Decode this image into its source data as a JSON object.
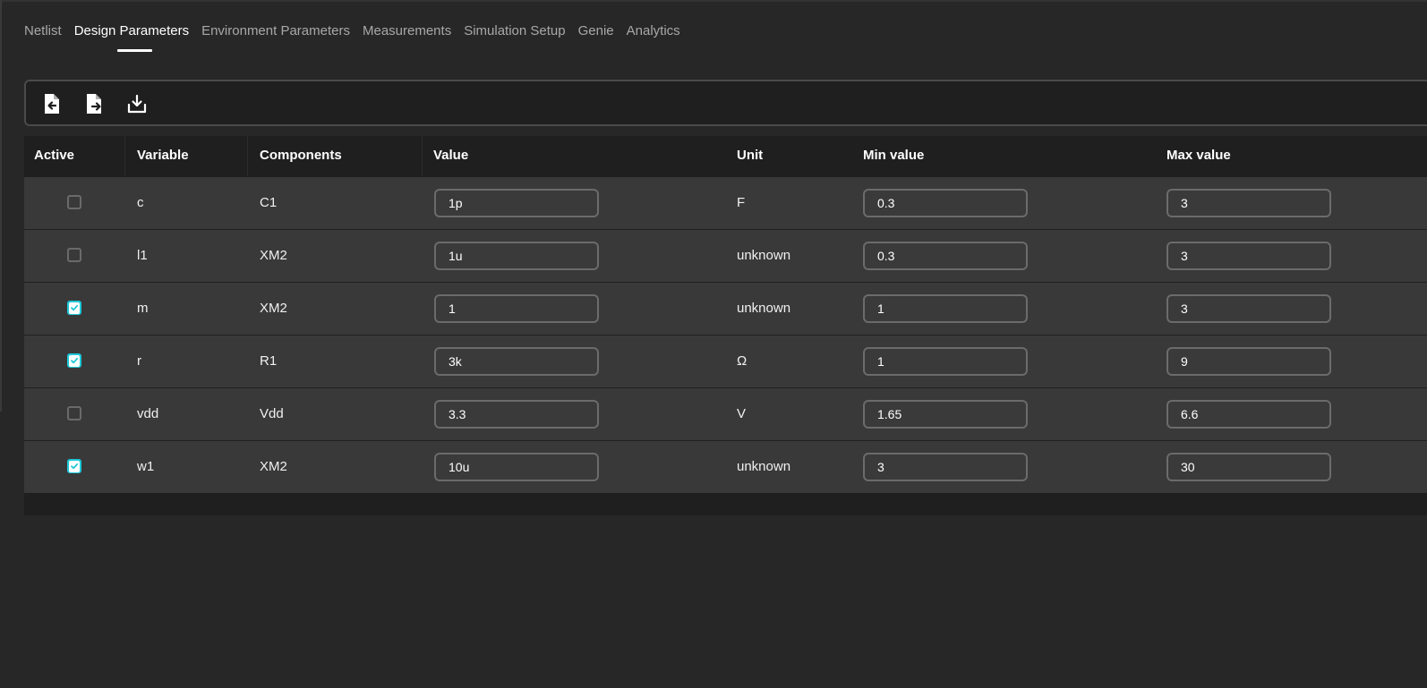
{
  "tabs": [
    {
      "label": "Netlist"
    },
    {
      "label": "Design Parameters"
    },
    {
      "label": "Environment Parameters"
    },
    {
      "label": "Measurements"
    },
    {
      "label": "Simulation Setup"
    },
    {
      "label": "Genie"
    },
    {
      "label": "Analytics"
    }
  ],
  "active_tab": "Design Parameters",
  "toolbar": {
    "buttons": [
      "file-import-icon",
      "file-export-icon",
      "download-icon"
    ]
  },
  "columns": {
    "active": "Active",
    "variable": "Variable",
    "components": "Components",
    "value": "Value",
    "unit": "Unit",
    "min": "Min value",
    "max": "Max value"
  },
  "rows": [
    {
      "active": false,
      "variable": "c",
      "components": "C1",
      "value": "1p",
      "unit": "F",
      "min": "0.3",
      "max": "3"
    },
    {
      "active": false,
      "variable": "l1",
      "components": "XM2",
      "value": "1u",
      "unit": "unknown",
      "min": "0.3",
      "max": "3"
    },
    {
      "active": true,
      "variable": "m",
      "components": "XM2",
      "value": "1",
      "unit": "unknown",
      "min": "1",
      "max": "3"
    },
    {
      "active": true,
      "variable": "r",
      "components": "R1",
      "value": "3k",
      "unit": "Ω",
      "min": "1",
      "max": "9"
    },
    {
      "active": false,
      "variable": "vdd",
      "components": "Vdd",
      "value": "3.3",
      "unit": "V",
      "min": "1.65",
      "max": "6.6"
    },
    {
      "active": true,
      "variable": "w1",
      "components": "XM2",
      "value": "10u",
      "unit": "unknown",
      "min": "3",
      "max": "30"
    }
  ],
  "colors": {
    "accent": "#1ec8d8",
    "background": "#272727",
    "row": "#393939",
    "header": "#1f1f1f"
  }
}
